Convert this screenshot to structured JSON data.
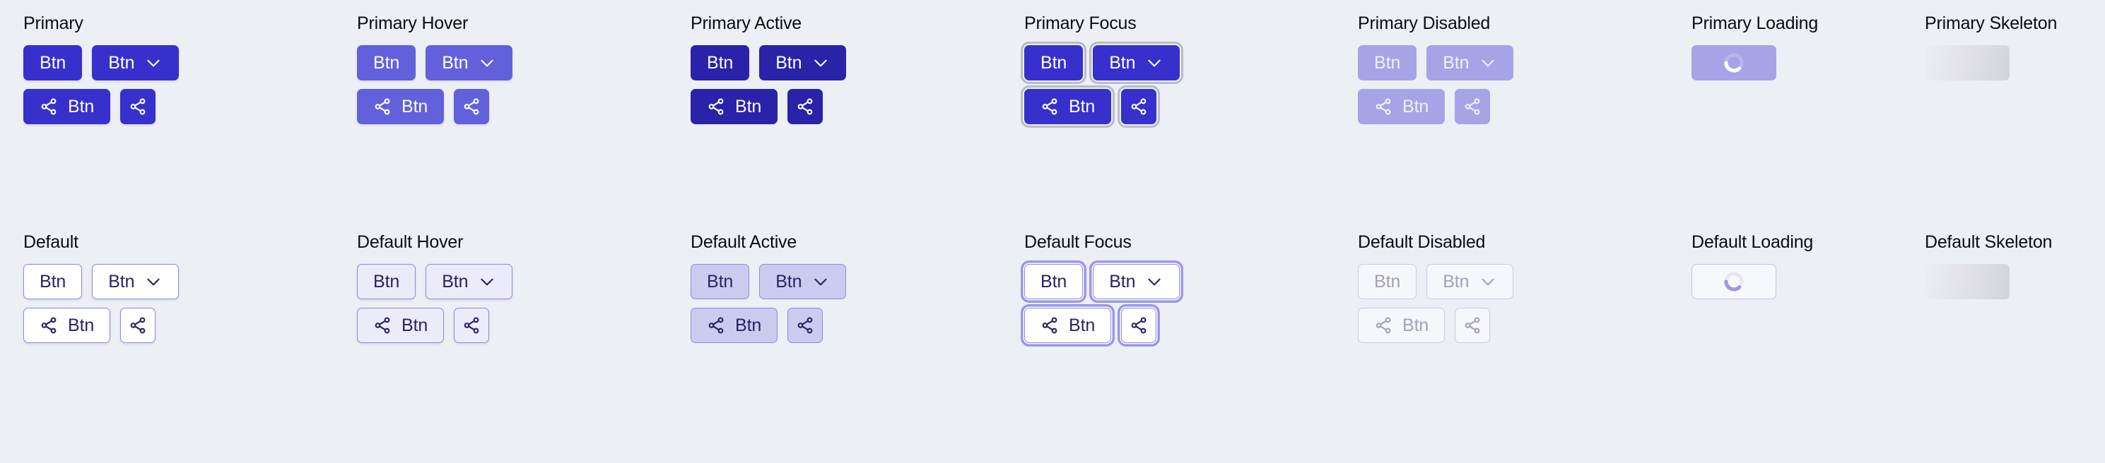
{
  "page": {
    "background_color": "#eceff4",
    "title_color": "#0c0c10"
  },
  "labels": {
    "btn": "Btn"
  },
  "icons": {
    "chevron": "chevron-down-icon",
    "share": "share-icon",
    "spinner": "loading-spinner-icon"
  },
  "palette": {
    "primary": "#3730cc",
    "primary_hover": "#6360dc",
    "primary_active": "#2a22a8",
    "primary_disabled": "#a6a3e6",
    "default_text": "#272463",
    "default_border": "#8d89e0",
    "default_hover_bg": "#ecebf9",
    "default_active_bg": "#cdcaf0",
    "default_disabled_text": "#a3a2bd",
    "focus_ring_primary": "#b9bcc6",
    "focus_ring_default": "#9b97e4",
    "skeleton_from": "#eceef1",
    "skeleton_to": "#d3d3dc"
  },
  "rows": [
    {
      "key": "primary",
      "columns": [
        {
          "key": "primary",
          "title": "Primary",
          "kind": "buttons"
        },
        {
          "key": "primary-hover",
          "title": "Primary Hover",
          "kind": "buttons"
        },
        {
          "key": "primary-active",
          "title": "Primary Active",
          "kind": "buttons"
        },
        {
          "key": "primary-focus",
          "title": "Primary Focus",
          "kind": "buttons"
        },
        {
          "key": "primary-disabled",
          "title": "Primary Disabled",
          "kind": "buttons"
        },
        {
          "key": "primary-loading",
          "title": "Primary Loading",
          "kind": "loading"
        },
        {
          "key": "primary-skeleton",
          "title": "Primary Skeleton",
          "kind": "skeleton"
        }
      ]
    },
    {
      "key": "default",
      "columns": [
        {
          "key": "default",
          "title": "Default",
          "kind": "buttons"
        },
        {
          "key": "default-hover",
          "title": "Default Hover",
          "kind": "buttons"
        },
        {
          "key": "default-active",
          "title": "Default Active",
          "kind": "buttons"
        },
        {
          "key": "default-focus",
          "title": "Default Focus",
          "kind": "buttons"
        },
        {
          "key": "default-disabled",
          "title": "Default Disabled",
          "kind": "buttons"
        },
        {
          "key": "default-loading",
          "title": "Default Loading",
          "kind": "loading"
        },
        {
          "key": "default-skeleton",
          "title": "Default Skeleton",
          "kind": "skeleton"
        }
      ]
    }
  ],
  "titles": {
    "primary": "Primary",
    "primary_hover": "Primary Hover",
    "primary_active": "Primary Active",
    "primary_focus": "Primary Focus",
    "primary_disabled": "Primary Disabled",
    "primary_loading": "Primary Loading",
    "primary_skeleton": "Primary Skeleton",
    "default": "Default",
    "default_hover": "Default Hover",
    "default_active": "Default Active",
    "default_focus": "Default Focus",
    "default_disabled": "Default Disabled",
    "default_loading": "Default Loading",
    "default_skeleton": "Default Skeleton"
  }
}
